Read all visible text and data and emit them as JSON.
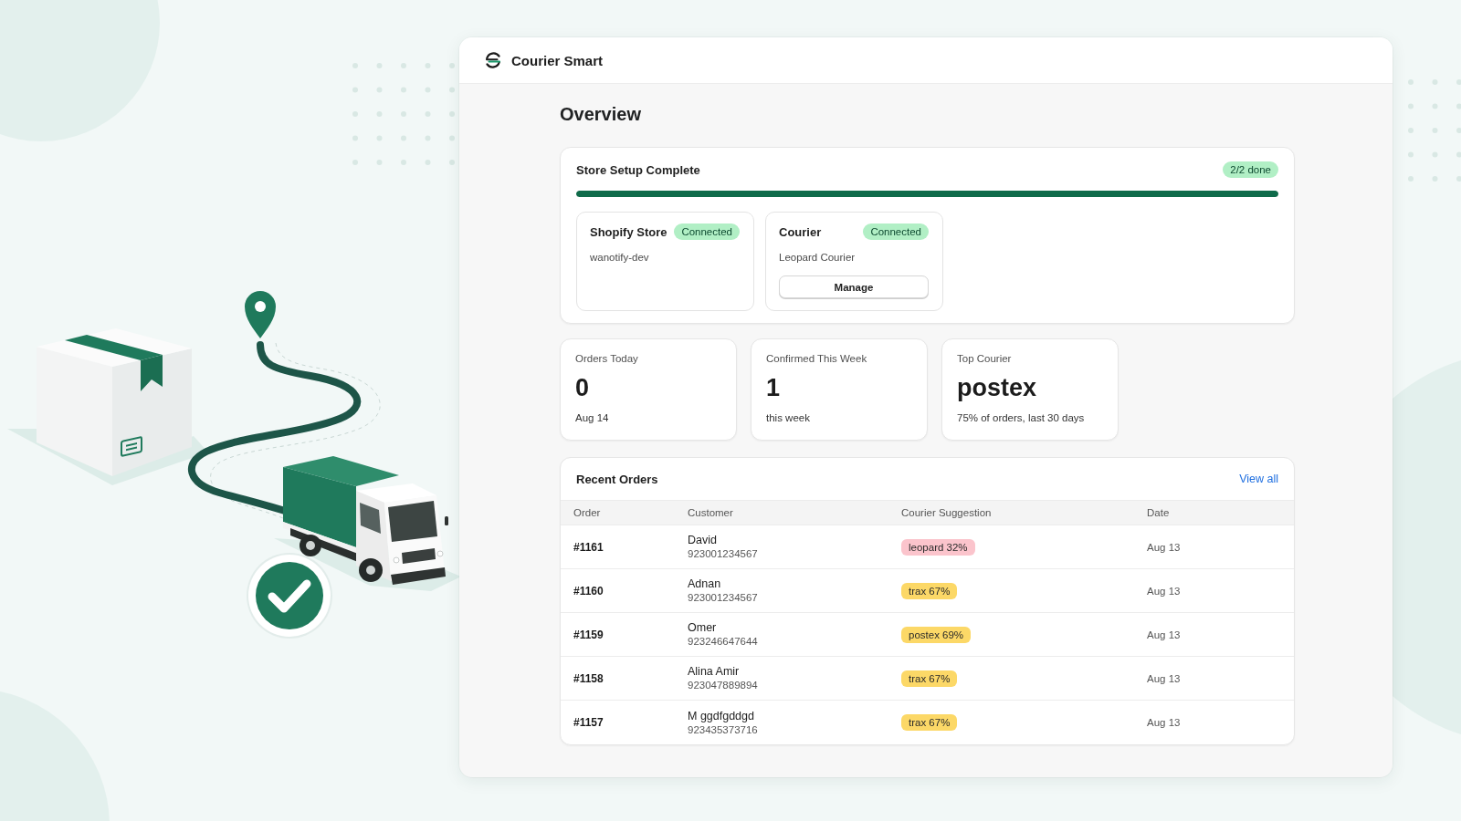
{
  "app": {
    "name": "Courier Smart"
  },
  "page": {
    "title": "Overview"
  },
  "setup": {
    "title": "Store Setup Complete",
    "badge": "2/2 done",
    "progress": {
      "level": 1
    },
    "connections": [
      {
        "title": "Shopify Store",
        "status": "Connected",
        "detail": "wanotify-dev"
      },
      {
        "title": "Courier",
        "status": "Connected",
        "detail": "Leopard Courier",
        "button": "Manage"
      }
    ]
  },
  "stats": [
    {
      "label": "Orders Today",
      "value": "0",
      "note": "Aug 14"
    },
    {
      "label": "Confirmed This Week",
      "value": "1",
      "note": "this week"
    },
    {
      "label": "Top Courier",
      "value": "postex",
      "note": "75% of orders, last 30 days"
    }
  ],
  "orders": {
    "title": "Recent Orders",
    "link": "View all",
    "columns": [
      "Order",
      "Customer",
      "Courier Suggestion",
      "Date"
    ],
    "rows": [
      {
        "order": "#1161",
        "customer": "David",
        "phone": "923001234567",
        "suggestion": "leopard 32%",
        "color": "#fbc4cc",
        "date": "Aug 13"
      },
      {
        "order": "#1160",
        "customer": "Adnan",
        "phone": "923001234567",
        "suggestion": "trax 67%",
        "color": "#fcd867",
        "date": "Aug 13"
      },
      {
        "order": "#1159",
        "customer": "Omer",
        "phone": "923246647644",
        "suggestion": "postex 69%",
        "color": "#fcd867",
        "date": "Aug 13"
      },
      {
        "order": "#1158",
        "customer": "Alina Amir",
        "phone": "923047889894",
        "suggestion": "trax 67%",
        "color": "#fcd867",
        "date": "Aug 13"
      },
      {
        "order": "#1157",
        "customer": "M ggdfgddgd",
        "phone": "923435373716",
        "suggestion": "trax 67%",
        "color": "#fcd867",
        "date": "Aug 13"
      }
    ]
  }
}
